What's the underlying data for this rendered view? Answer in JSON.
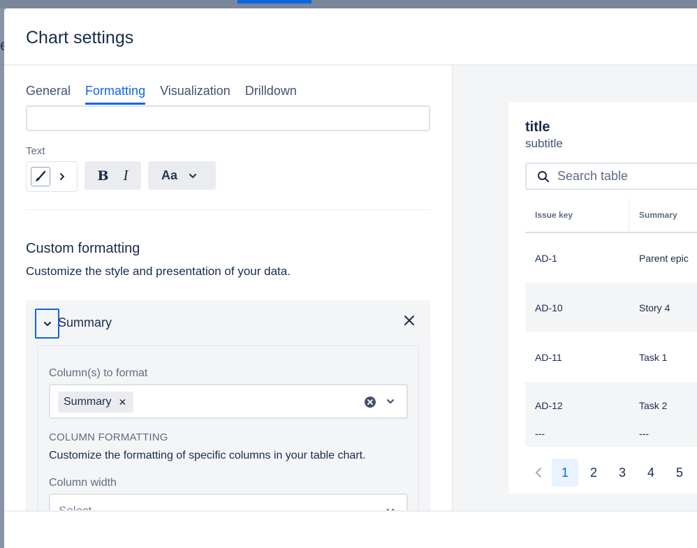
{
  "backdrop": {
    "letter": "e"
  },
  "modal": {
    "title": "Chart settings"
  },
  "tabs": [
    {
      "label": "General",
      "active": false
    },
    {
      "label": "Formatting",
      "active": true
    },
    {
      "label": "Visualization",
      "active": false
    },
    {
      "label": "Drilldown",
      "active": false
    }
  ],
  "text_section": {
    "label": "Text",
    "bold_label": "B",
    "italic_label": "I",
    "font_size_label": "Aa"
  },
  "custom_formatting": {
    "title": "Custom formatting",
    "description": "Customize the style and presentation of your data.",
    "rule": {
      "name": "Summary",
      "columns_label": "Column(s) to format",
      "selected_columns": [
        "Summary"
      ],
      "section_caption": "COLUMN FORMATTING",
      "section_description": "Customize the formatting of specific columns in your table chart.",
      "width_label": "Column width",
      "width_placeholder": "Select"
    }
  },
  "preview": {
    "title": "title",
    "subtitle": "subtitle",
    "search_placeholder": "Search table",
    "columns": [
      "Issue key",
      "Summary"
    ],
    "rows": [
      {
        "key": "AD-1",
        "summary": "Parent epic"
      },
      {
        "key": "AD-10",
        "summary": "Story 4"
      },
      {
        "key": "AD-11",
        "summary": "Task 1"
      },
      {
        "key": "AD-12",
        "summary": "Task 2"
      }
    ],
    "extra_row": {
      "key": "---",
      "summary": "---"
    },
    "pages": [
      "1",
      "2",
      "3",
      "4",
      "5"
    ],
    "current_page": "1"
  },
  "colors": {
    "accent": "#0c66e4",
    "text": "#172b4d",
    "subtle": "#5e6c84"
  }
}
